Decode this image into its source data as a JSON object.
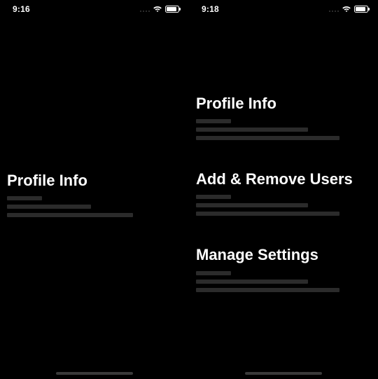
{
  "left": {
    "status": {
      "time": "9:16"
    },
    "sections": [
      {
        "title": "Profile Info"
      }
    ]
  },
  "right": {
    "status": {
      "time": "9:18"
    },
    "sections": [
      {
        "title": "Profile Info"
      },
      {
        "title": "Add & Remove Users"
      },
      {
        "title": "Manage Settings"
      }
    ]
  }
}
